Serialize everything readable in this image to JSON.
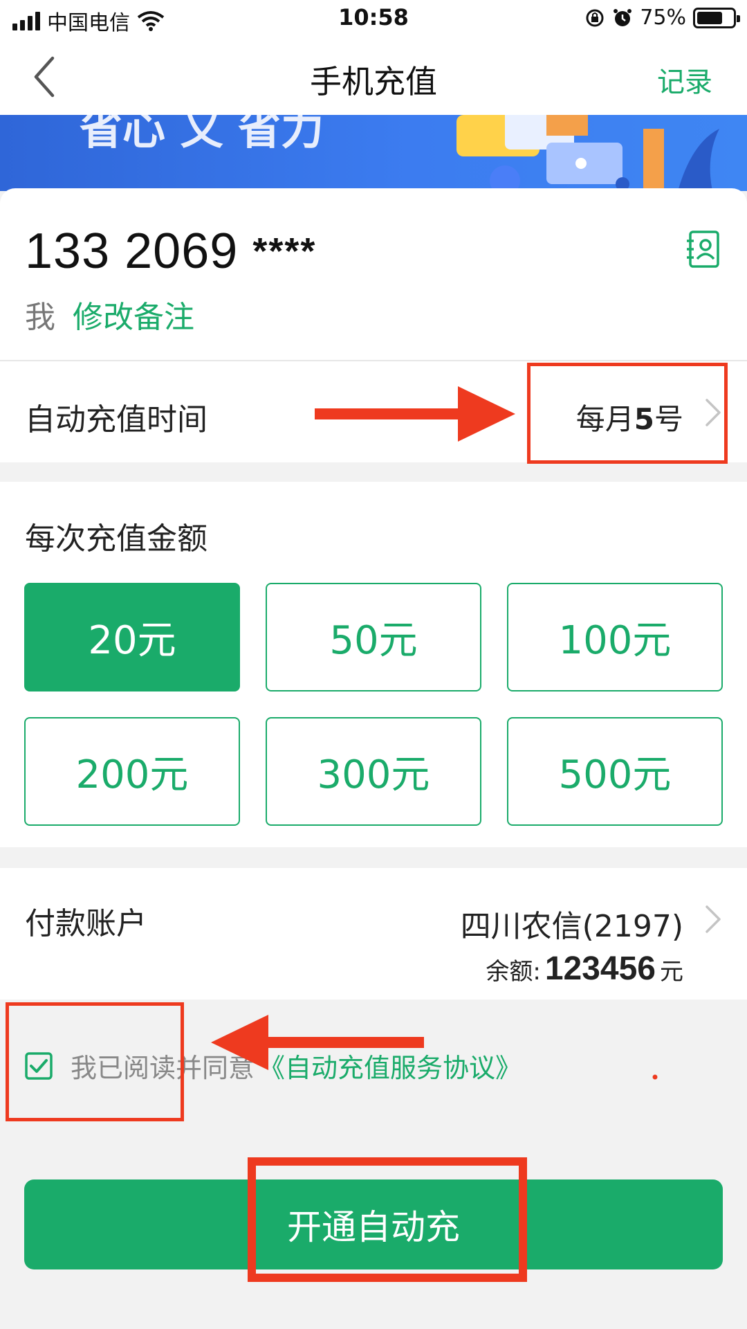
{
  "status_bar": {
    "carrier": "中国电信",
    "time": "10:58",
    "battery": "75%",
    "battery_level": 0.75
  },
  "nav": {
    "title": "手机充值",
    "record": "记录"
  },
  "banner": {
    "text": "省心 又 省力"
  },
  "phone": {
    "number_visible": "133 2069",
    "number_masked": "****",
    "owner": "我",
    "edit_note": "修改备注"
  },
  "auto_time": {
    "label": "自动充值时间",
    "value_prefix": "每月",
    "value_day": "5",
    "value_suffix": "号"
  },
  "amount": {
    "label": "每次充值金额",
    "options": [
      "20元",
      "50元",
      "100元",
      "200元",
      "300元",
      "500元"
    ],
    "selected_index": 0
  },
  "account": {
    "label": "付款账户",
    "bank": "四川农信(2197)",
    "balance_label": "余额:",
    "balance_value": "123456",
    "balance_unit": "元"
  },
  "agreement": {
    "checked": true,
    "text": "我已阅读并同意",
    "link": "《自动充值服务协议》"
  },
  "submit": {
    "label": "开通自动充"
  },
  "colors": {
    "accent": "#1aab6a",
    "annotation": "#ee3a1f",
    "banner": "#3c7cf0"
  },
  "icons": [
    "back-icon",
    "contact-book-icon",
    "chevron-right-icon",
    "checkbox-checked-icon",
    "wifi-icon",
    "alarm-icon",
    "lock-rotation-icon"
  ]
}
